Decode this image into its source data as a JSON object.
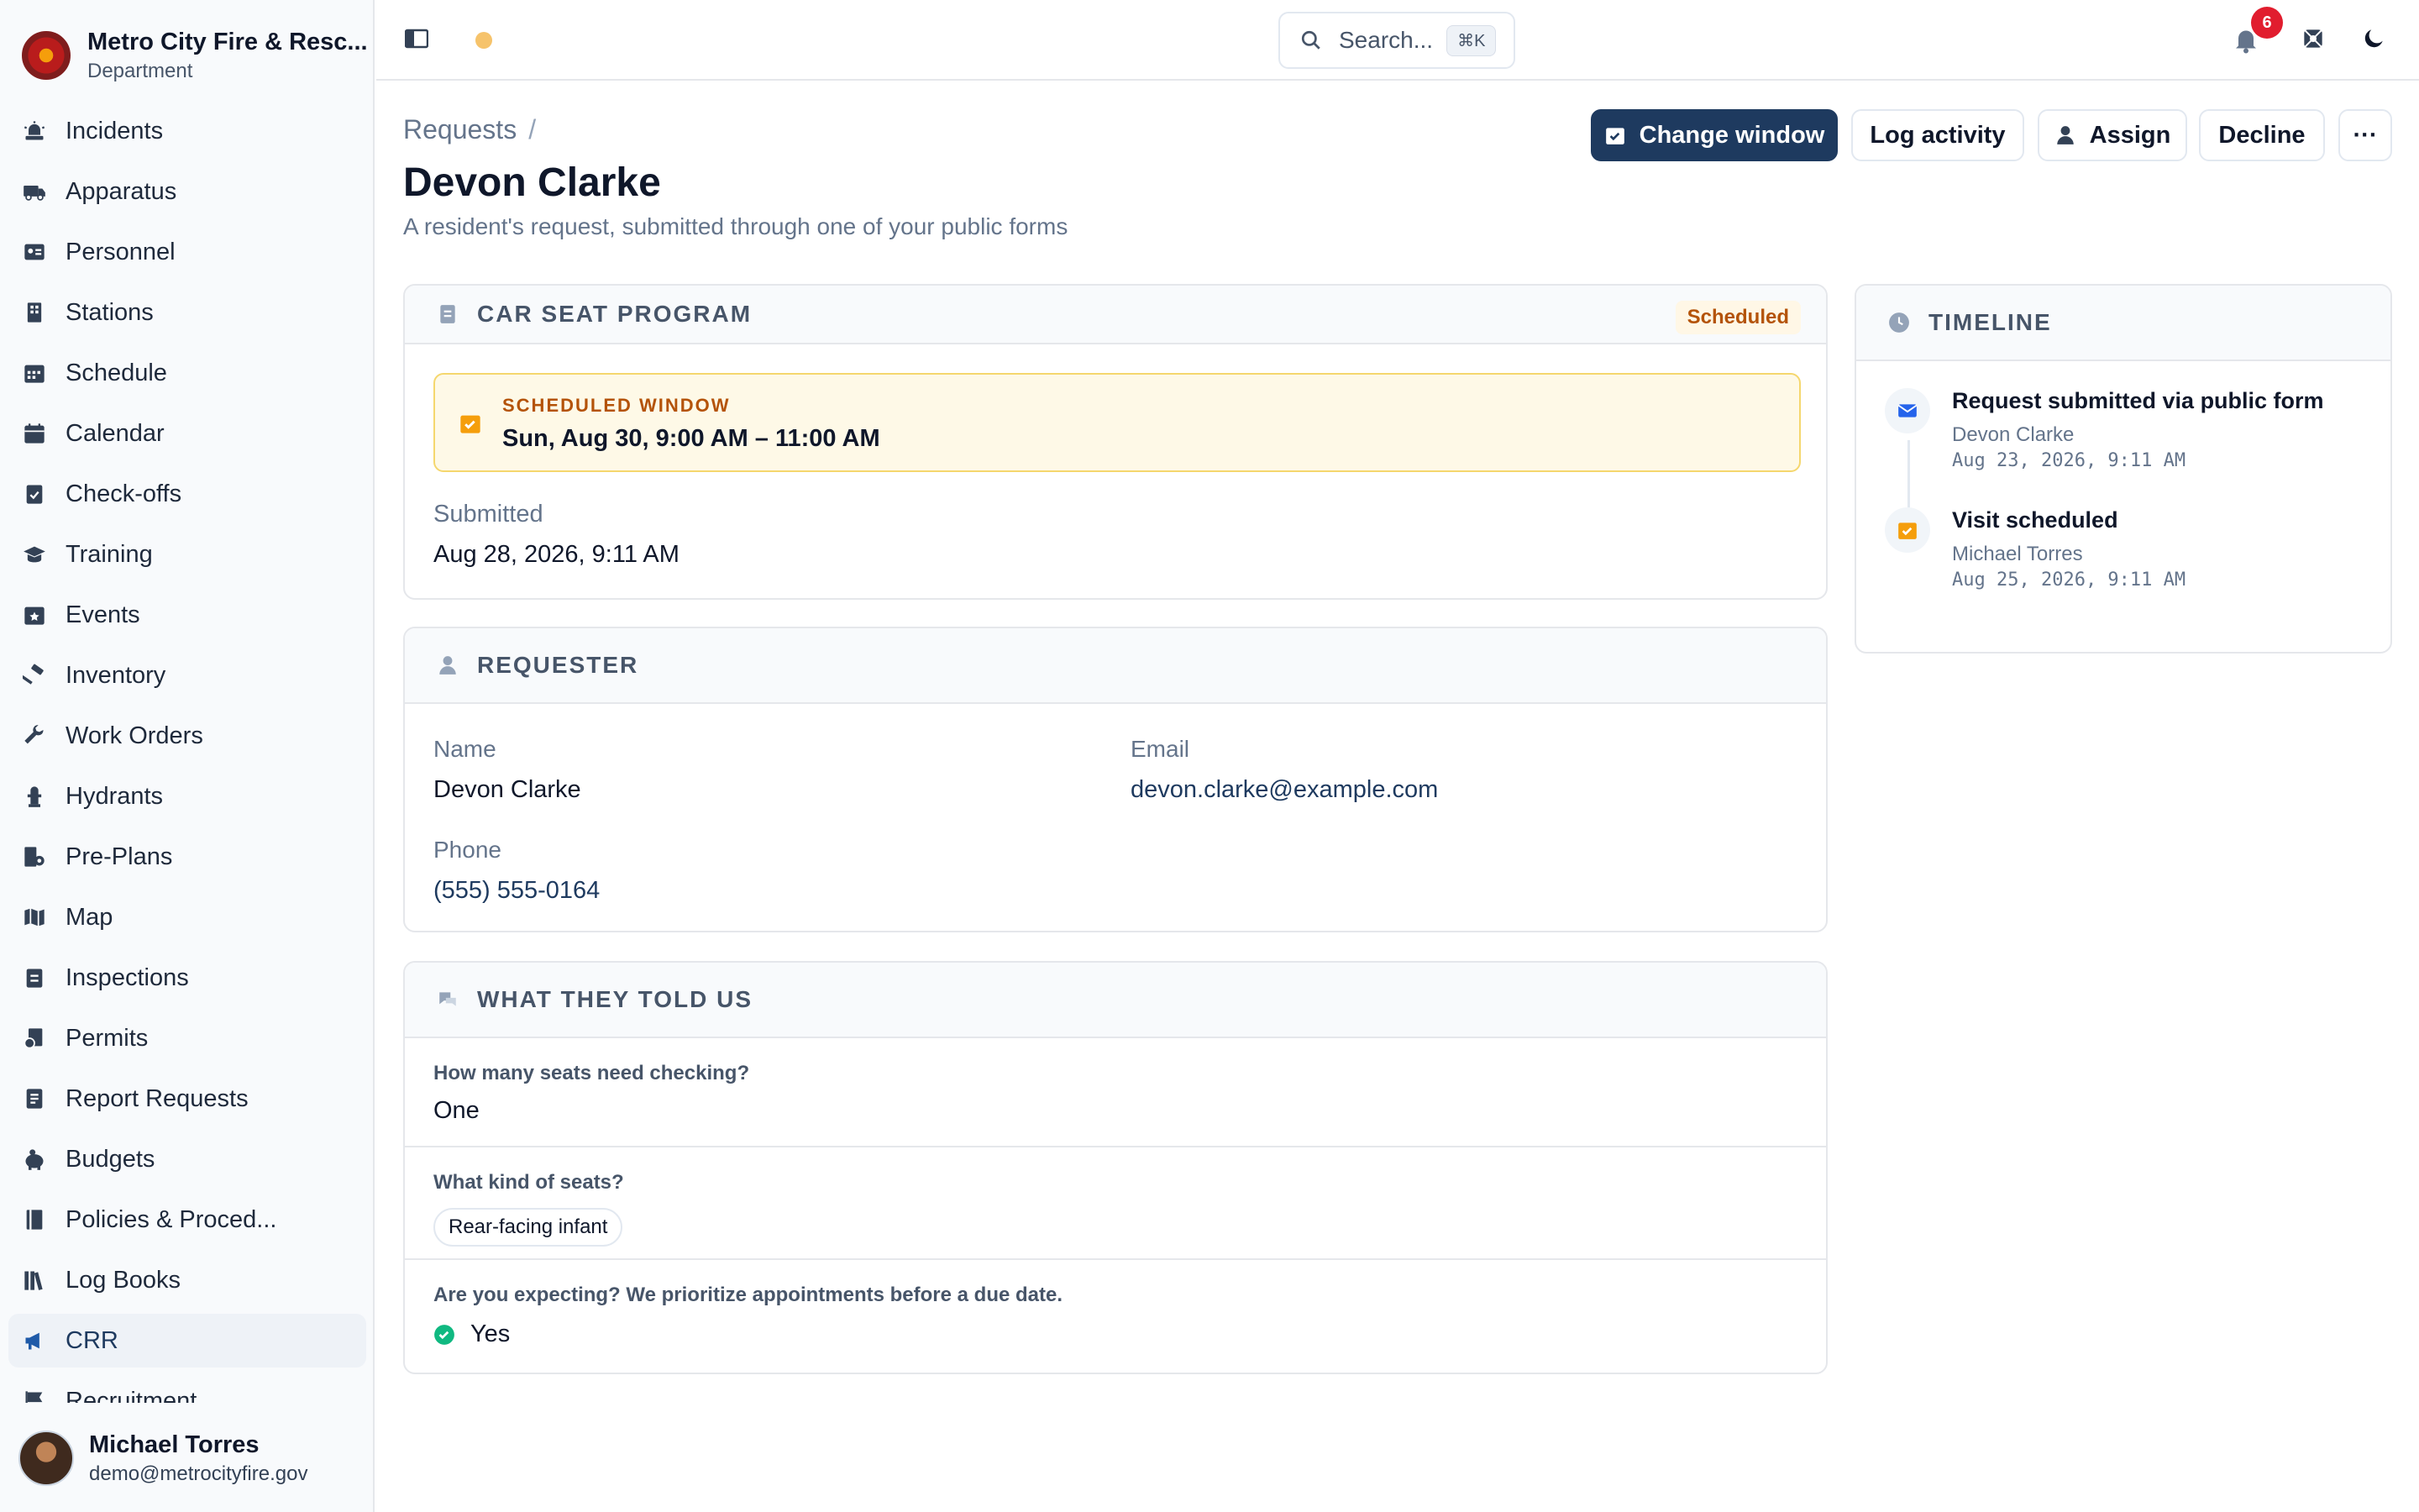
{
  "org": {
    "name": "Metro City Fire & Resc...",
    "subtitle": "Department"
  },
  "sidebar": {
    "items": [
      {
        "label": "Incidents",
        "icon": "siren-icon"
      },
      {
        "label": "Apparatus",
        "icon": "truck-icon"
      },
      {
        "label": "Personnel",
        "icon": "id-card-icon"
      },
      {
        "label": "Stations",
        "icon": "building-icon"
      },
      {
        "label": "Schedule",
        "icon": "calendar-grid-icon"
      },
      {
        "label": "Calendar",
        "icon": "calendar-icon"
      },
      {
        "label": "Check-offs",
        "icon": "clipboard-check-icon"
      },
      {
        "label": "Training",
        "icon": "graduation-cap-icon"
      },
      {
        "label": "Events",
        "icon": "calendar-star-icon"
      },
      {
        "label": "Inventory",
        "icon": "hammer-icon"
      },
      {
        "label": "Work Orders",
        "icon": "wrench-icon"
      },
      {
        "label": "Hydrants",
        "icon": "hydrant-icon"
      },
      {
        "label": "Pre-Plans",
        "icon": "blueprint-icon"
      },
      {
        "label": "Map",
        "icon": "map-icon"
      },
      {
        "label": "Inspections",
        "icon": "clipboard-icon"
      },
      {
        "label": "Permits",
        "icon": "permit-icon"
      },
      {
        "label": "Report Requests",
        "icon": "report-icon"
      },
      {
        "label": "Budgets",
        "icon": "piggy-bank-icon"
      },
      {
        "label": "Policies & Proced...",
        "icon": "book-icon"
      },
      {
        "label": "Log Books",
        "icon": "books-icon"
      },
      {
        "label": "CRR",
        "icon": "megaphone-icon",
        "active": true
      },
      {
        "label": "Recruitment",
        "icon": "flag-icon"
      }
    ]
  },
  "user": {
    "name": "Michael Torres",
    "email": "demo@metrocityfire.gov"
  },
  "topbar": {
    "search_placeholder": "Search...",
    "search_shortcut": "⌘K",
    "notifications_count": "6"
  },
  "header": {
    "breadcrumb": "Requests",
    "breadcrumb_sep": "/",
    "title": "Devon Clarke",
    "subtitle": "A resident's request, submitted through one of your public forms",
    "actions": {
      "change_window": "Change window",
      "log_activity": "Log activity",
      "assign": "Assign",
      "decline": "Decline",
      "more": "···"
    }
  },
  "program": {
    "title": "CAR SEAT PROGRAM",
    "status": "Scheduled",
    "window_label": "SCHEDULED WINDOW",
    "window_value": "Sun, Aug 30, 9:00 AM – 11:00 AM",
    "submitted_label": "Submitted",
    "submitted_value": "Aug 28, 2026, 9:11 AM"
  },
  "requester": {
    "title": "REQUESTER",
    "name_label": "Name",
    "name": "Devon Clarke",
    "email_label": "Email",
    "email": "devon.clarke@example.com",
    "phone_label": "Phone",
    "phone": "(555) 555-0164"
  },
  "told": {
    "title": "WHAT THEY TOLD US",
    "q1": "How many seats need checking?",
    "a1": "One",
    "q2": "What kind of seats?",
    "a2": "Rear-facing infant",
    "q3": "Are you expecting? We prioritize appointments before a due date.",
    "a3": "Yes"
  },
  "timeline": {
    "title": "TIMELINE",
    "items": [
      {
        "title": "Request submitted via public form",
        "who": "Devon Clarke",
        "when": "Aug 23, 2026, 9:11 AM"
      },
      {
        "title": "Visit scheduled",
        "who": "Michael Torres",
        "when": "Aug 25, 2026, 9:11 AM"
      }
    ]
  },
  "colors": {
    "primary": "#1e3a5f",
    "warning": "#b45309",
    "warning_bg": "#fef9e7",
    "success": "#10b981",
    "badge": "#e11d2e"
  }
}
